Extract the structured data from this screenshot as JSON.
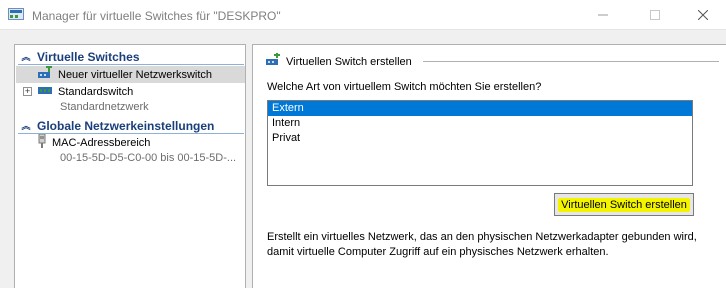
{
  "window": {
    "title": "Manager für virtuelle Switches für \"DESKPRO\"",
    "minimize_glyph": "—",
    "maximize_glyph": "☐"
  },
  "sidebar": {
    "sections": [
      {
        "header": "Virtuelle Switches",
        "items": [
          {
            "label": "Neuer virtueller Netzwerkswitch",
            "selected": true,
            "icon": "add-switch-icon"
          },
          {
            "label": "Standardswitch",
            "sublabel": "Standardnetzwerk",
            "expander": "+",
            "icon": "switch-icon"
          }
        ]
      },
      {
        "header": "Globale Netzwerkeinstellungen",
        "items": [
          {
            "label": "MAC-Adressbereich",
            "sublabel": "00-15-5D-D5-C0-00 bis 00-15-5D-...",
            "icon": "mac-address-icon"
          }
        ]
      }
    ],
    "chevron_glyph": "︽"
  },
  "main": {
    "title": "Virtuellen Switch erstellen",
    "question": "Welche Art von virtuellem Switch möchten Sie erstellen?",
    "switch_types": [
      "Extern",
      "Intern",
      "Privat"
    ],
    "selected_type": "Extern",
    "create_button": "Virtuellen Switch erstellen",
    "description": "Erstellt ein virtuelles Netzwerk, das an den physischen Netzwerkadapter gebunden wird, damit virtuelle Computer Zugriff auf ein physisches Netzwerk erhalten."
  },
  "colors": {
    "section_header": "#1a3f7a",
    "selection_blue": "#0078d7",
    "highlight_yellow": "#f4f400",
    "icon_green": "#3a9a3a",
    "icon_blue": "#2f6db5"
  }
}
